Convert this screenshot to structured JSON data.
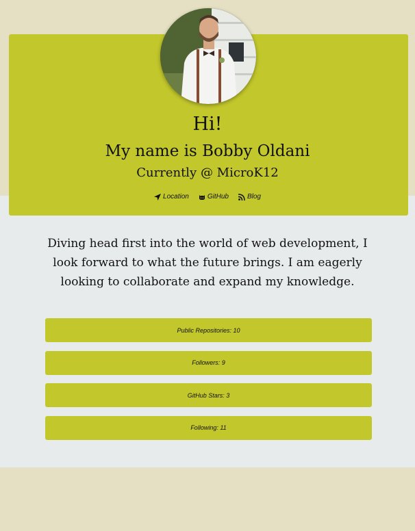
{
  "header": {
    "greeting": "Hi!",
    "name": "My name is Bobby Oldani",
    "company": "Currently @ MicroK12"
  },
  "links": [
    {
      "label": "Location",
      "icon": "location-arrow-icon"
    },
    {
      "label": "GitHub",
      "icon": "github-icon"
    },
    {
      "label": "Blog",
      "icon": "rss-icon"
    }
  ],
  "bio": "Diving head first into the world of web development, I look forward to what the future brings. I am eagerly looking to collaborate and expand my knowledge.",
  "stats": [
    {
      "label": "Public Repositories: 10"
    },
    {
      "label": "Followers: 9"
    },
    {
      "label": "GitHub Stars: 3"
    },
    {
      "label": "Following: 11"
    }
  ],
  "colors": {
    "accent": "#c2c72b",
    "page_background": "#e5e0c3",
    "content_background": "#e8ebec",
    "text": "#111111"
  }
}
